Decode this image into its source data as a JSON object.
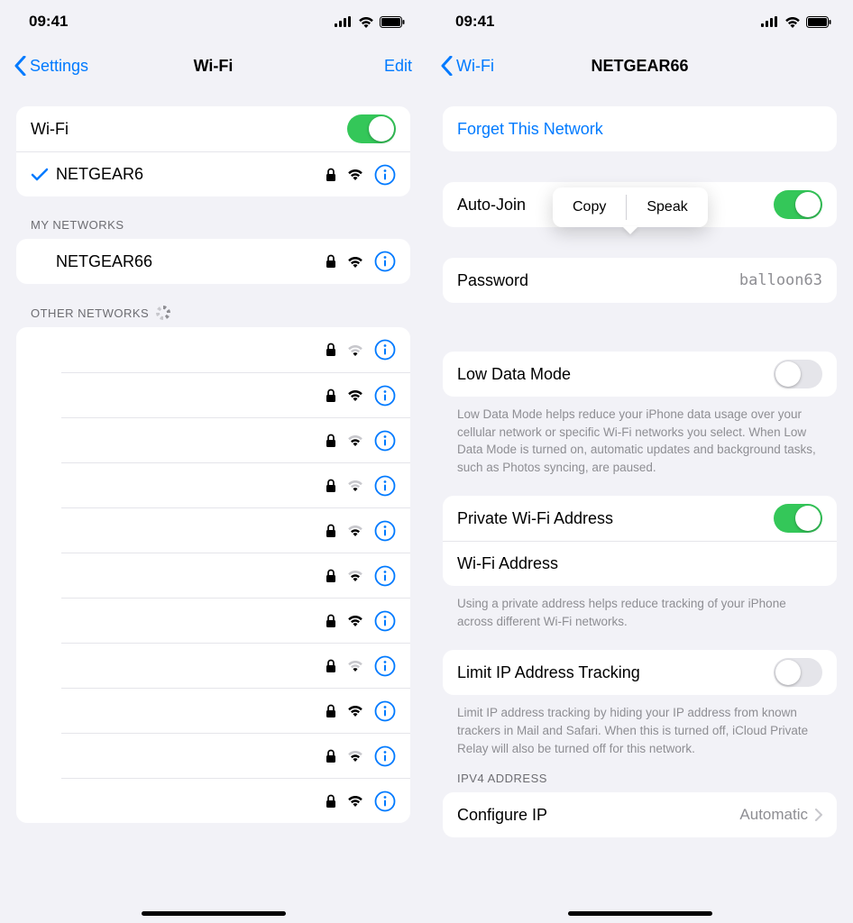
{
  "status": {
    "time": "09:41"
  },
  "left": {
    "back": "Settings",
    "title": "Wi-Fi",
    "edit": "Edit",
    "wifi_label": "Wi-Fi",
    "wifi_on": true,
    "connected": {
      "name": "NETGEAR6"
    },
    "my_header": "MY NETWORKS",
    "my": [
      {
        "name": "NETGEAR66"
      }
    ],
    "other_header": "OTHER NETWORKS",
    "other_count": 11
  },
  "right": {
    "back": "Wi-Fi",
    "title": "NETGEAR66",
    "forget": "Forget This Network",
    "autojoin_label": "Auto-Join",
    "autojoin_on": true,
    "copy": "Copy",
    "speak": "Speak",
    "password_label": "Password",
    "password_value": "balloon63",
    "lowdata_label": "Low Data Mode",
    "lowdata_on": false,
    "lowdata_foot": "Low Data Mode helps reduce your iPhone data usage over your cellular network or specific Wi-Fi networks you select. When Low Data Mode is turned on, automatic updates and background tasks, such as Photos syncing, are paused.",
    "private_label": "Private Wi-Fi Address",
    "private_on": true,
    "wifi_addr_label": "Wi-Fi Address",
    "private_foot": "Using a private address helps reduce tracking of your iPhone across different Wi-Fi networks.",
    "limit_label": "Limit IP Address Tracking",
    "limit_on": false,
    "limit_foot": "Limit IP address tracking by hiding your IP address from known trackers in Mail and Safari. When this is turned off, iCloud Private Relay will also be turned off for this network.",
    "ipv4_header": "IPV4 ADDRESS",
    "configure_label": "Configure IP",
    "configure_value": "Automatic"
  }
}
